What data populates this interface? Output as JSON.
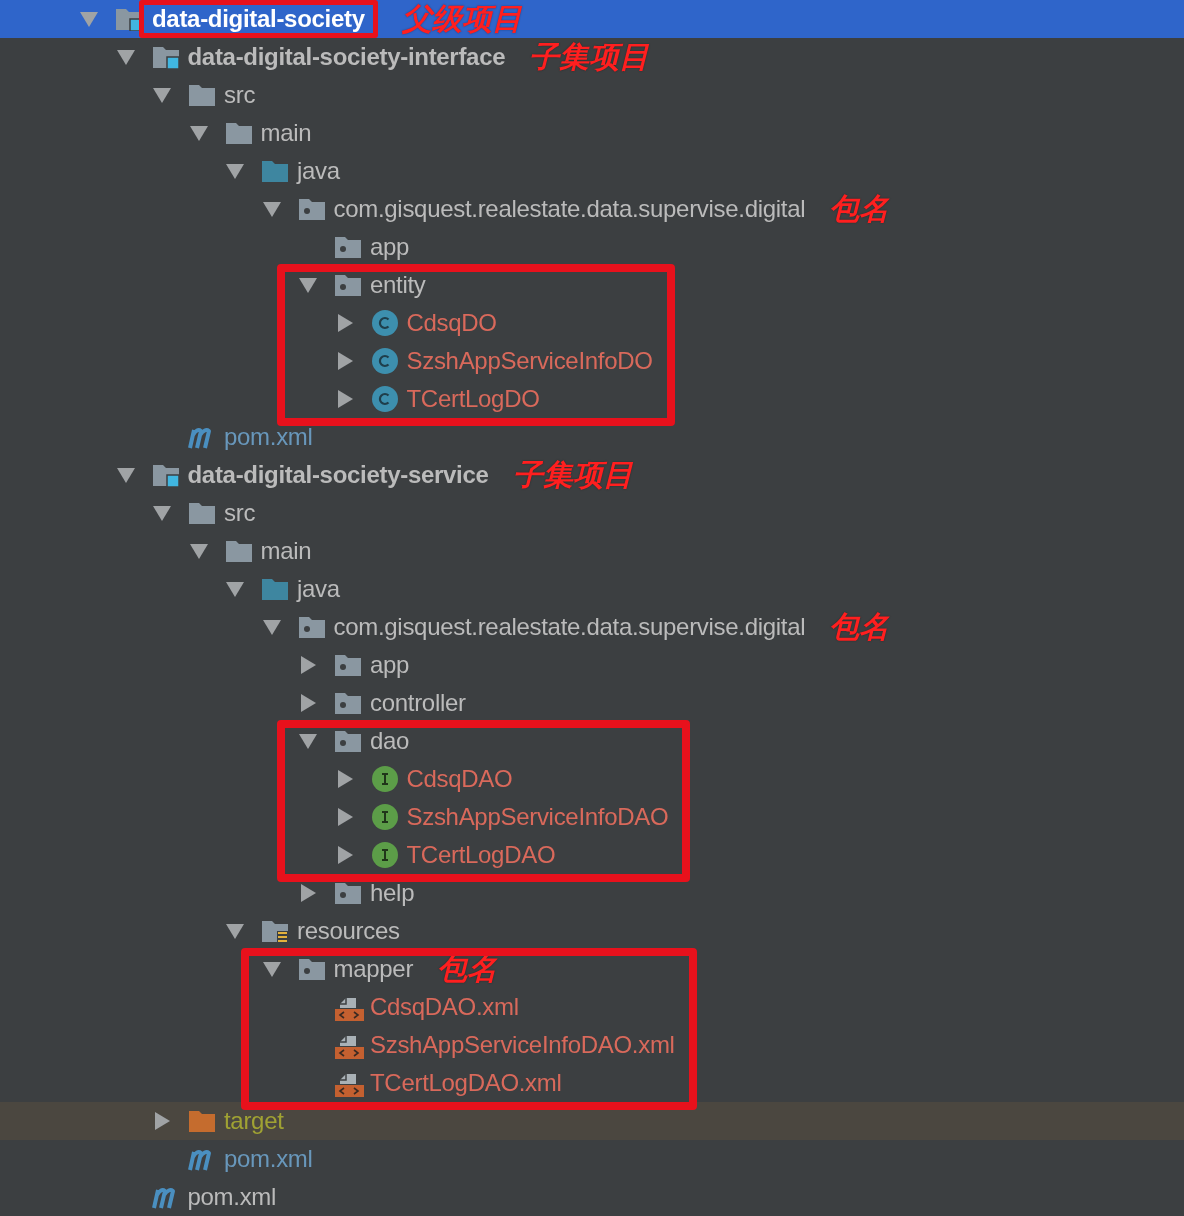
{
  "tree": [
    {
      "label": "data-digital-society",
      "kind": "module",
      "selected": true,
      "expanded": true,
      "boxed": true,
      "note": "父级项目",
      "children": [
        {
          "label": "data-digital-society-interface",
          "kind": "module",
          "selected": false,
          "expanded": true,
          "note": "子集项目",
          "children": [
            {
              "label": "src",
              "kind": "folder",
              "selected": false,
              "expanded": true,
              "children": [
                {
                  "label": "main",
                  "kind": "folder",
                  "selected": false,
                  "expanded": true,
                  "children": [
                    {
                      "label": "java",
                      "kind": "source-folder",
                      "selected": false,
                      "expanded": true,
                      "children": [
                        {
                          "label": "com.gisquest.realestate.data.supervise.digital",
                          "kind": "package",
                          "selected": false,
                          "expanded": true,
                          "note": "包名",
                          "children": [
                            {
                              "label": "app",
                              "kind": "package",
                              "selected": false
                            },
                            {
                              "label": "entity",
                              "kind": "package",
                              "selected": false,
                              "expanded": true,
                              "boxed": true,
                              "children": [
                                {
                                  "label": "CdsqDO",
                                  "kind": "class",
                                  "color": "#d9695b",
                                  "selected": false,
                                  "expanded": false
                                },
                                {
                                  "label": "SzshAppServiceInfoDO",
                                  "kind": "class",
                                  "color": "#d9695b",
                                  "selected": false,
                                  "expanded": false
                                },
                                {
                                  "label": "TCertLogDO",
                                  "kind": "class",
                                  "color": "#d9695b",
                                  "selected": false,
                                  "expanded": false
                                }
                              ]
                            }
                          ]
                        }
                      ]
                    }
                  ]
                }
              ]
            },
            {
              "label": "pom.xml",
              "kind": "pom",
              "color": "#6897bb",
              "selected": false
            }
          ]
        },
        {
          "label": "data-digital-society-service",
          "kind": "module",
          "selected": false,
          "expanded": true,
          "note": "子集项目",
          "children": [
            {
              "label": "src",
              "kind": "folder",
              "selected": false,
              "expanded": true,
              "children": [
                {
                  "label": "main",
                  "kind": "folder",
                  "selected": false,
                  "expanded": true,
                  "children": [
                    {
                      "label": "java",
                      "kind": "source-folder",
                      "selected": false,
                      "expanded": true,
                      "children": [
                        {
                          "label": "com.gisquest.realestate.data.supervise.digital",
                          "kind": "package",
                          "selected": false,
                          "expanded": true,
                          "note": "包名",
                          "children": [
                            {
                              "label": "app",
                              "kind": "package",
                              "selected": false,
                              "expanded": false
                            },
                            {
                              "label": "controller",
                              "kind": "package",
                              "selected": false,
                              "expanded": false
                            },
                            {
                              "label": "dao",
                              "kind": "package",
                              "selected": false,
                              "expanded": true,
                              "boxed": true,
                              "children": [
                                {
                                  "label": "CdsqDAO",
                                  "kind": "interface",
                                  "color": "#d9695b",
                                  "selected": false,
                                  "expanded": false
                                },
                                {
                                  "label": "SzshAppServiceInfoDAO",
                                  "kind": "interface",
                                  "color": "#d9695b",
                                  "selected": false,
                                  "expanded": false
                                },
                                {
                                  "label": "TCertLogDAO",
                                  "kind": "interface",
                                  "color": "#d9695b",
                                  "selected": false,
                                  "expanded": false
                                }
                              ]
                            },
                            {
                              "label": "help",
                              "kind": "package",
                              "selected": false,
                              "expanded": false
                            }
                          ]
                        }
                      ]
                    },
                    {
                      "label": "resources",
                      "kind": "resources-folder",
                      "selected": false,
                      "expanded": true,
                      "children": [
                        {
                          "label": "mapper",
                          "kind": "package",
                          "selected": false,
                          "expanded": true,
                          "boxed": true,
                          "note": "包名",
                          "children": [
                            {
                              "label": "CdsqDAO.xml",
                              "kind": "xml",
                              "color": "#d9695b",
                              "selected": false
                            },
                            {
                              "label": "SzshAppServiceInfoDAO.xml",
                              "kind": "xml",
                              "color": "#d9695b",
                              "selected": false
                            },
                            {
                              "label": "TCertLogDAO.xml",
                              "kind": "xml",
                              "color": "#d9695b",
                              "selected": false
                            }
                          ]
                        }
                      ]
                    }
                  ]
                }
              ]
            },
            {
              "label": "target",
              "kind": "excluded-folder",
              "color": "#a0a233",
              "selected": false,
              "expanded": false
            },
            {
              "label": "pom.xml",
              "kind": "pom",
              "color": "#6897bb",
              "selected": false
            }
          ]
        },
        {
          "label": "pom.xml",
          "kind": "pom",
          "selected": false
        }
      ]
    }
  ]
}
